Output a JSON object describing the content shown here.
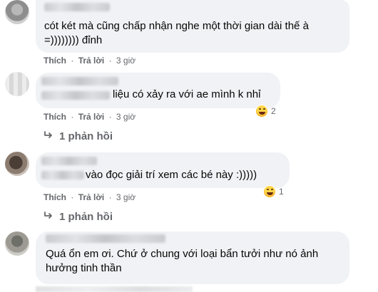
{
  "comments": [
    {
      "line1": "cót két mà cũng chấp nhận nghe một thời gian dài thế à",
      "line2": "=)))))))) đỉnh",
      "like": "Thích",
      "reply": "Trả lời",
      "sep": "·",
      "time": "3 giờ"
    },
    {
      "text": "liệu có xảy ra với ae mình k nhỉ",
      "like": "Thích",
      "reply": "Trả lời",
      "sep": "·",
      "time": "3 giờ",
      "reaction_icon": "laughing-emoji-icon",
      "reaction_count": "2",
      "replies_label": "1 phản hồi"
    },
    {
      "text": "vào đọc giải trí xem các bé này :)))))",
      "like": "Thích",
      "reply": "Trả lời",
      "sep": "·",
      "time": "3 giờ",
      "reaction_icon": "laughing-emoji-icon",
      "reaction_count": "1",
      "replies_label": "1 phản hồi"
    },
    {
      "line1": "Quá ổn em ơi. Chứ ở chung với loại bẩn tưởi như nó ảnh",
      "line2": "hưởng tinh thần"
    }
  ],
  "colors": {
    "bubble": "#f0f2f5",
    "secondary_text": "#65676b",
    "text": "#050505"
  }
}
